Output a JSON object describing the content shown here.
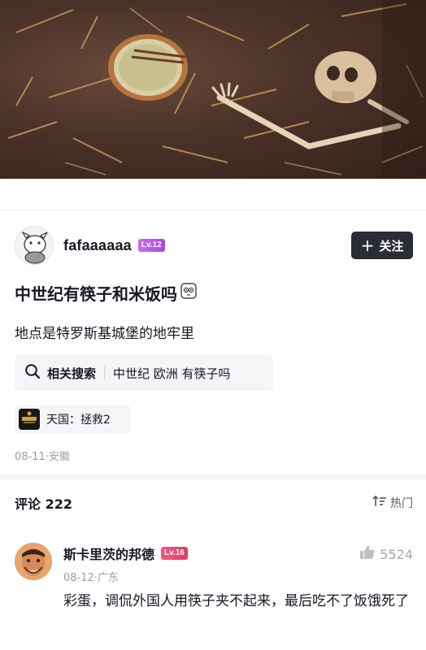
{
  "hero": {
    "alt_subject": "dungeon-floor-game-screenshot"
  },
  "author": {
    "name": "fafaaaaaa",
    "level": "Lv.12",
    "follow_label": "关注",
    "follow_icon": "plus-icon"
  },
  "post": {
    "title": "中世纪有筷子和米饭吗",
    "title_emoji": "😳",
    "body": "地点是特罗斯基城堡的地牢里",
    "related_search": {
      "label": "相关搜索",
      "query": "中世纪 欧洲 有筷子吗",
      "icon": "search-icon"
    },
    "game_tag": "天国：拯救2",
    "meta": "08-11·安徽"
  },
  "comments": {
    "title": "评论 222",
    "sort_label": "热门",
    "sort_icon": "sort-icon",
    "items": [
      {
        "author": "斯卡里茨的邦德",
        "level": "Lv.16",
        "likes": "5524",
        "meta": "08-12·广东",
        "text": "彩蛋，调侃外国人用筷子夹不起来，最后吃不了饭饿死了"
      }
    ]
  },
  "colors": {
    "follow_bg": "#2b2d35",
    "level12": "#b55ae8",
    "level16": "#e8446f",
    "chip_bg": "#f5f5f7",
    "muted_text": "#9a9ba1"
  }
}
